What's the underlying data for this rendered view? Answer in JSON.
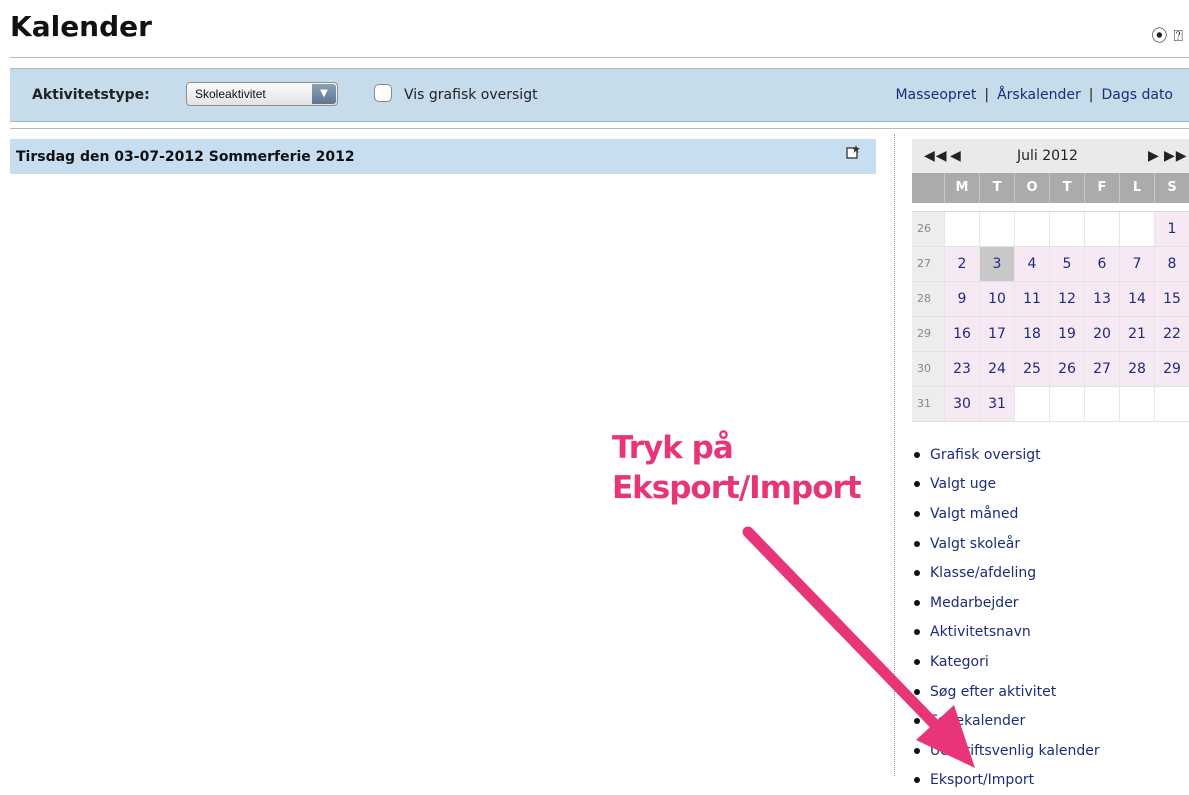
{
  "page": {
    "title": "Kalender"
  },
  "toolbar": {
    "activity_type_label": "Aktivitetstype:",
    "activity_type_value": "Skoleaktivitet",
    "graphic_overview_label": "Vis grafisk oversigt",
    "links": [
      "Masseopret",
      "Årskalender",
      "Dags dato"
    ],
    "separator": "|"
  },
  "day": {
    "heading": "Tirsdag den 03-07-2012  Sommerferie 2012"
  },
  "calendar": {
    "month_label": "Juli 2012",
    "prev_year": "◀◀",
    "prev_month": "◀",
    "next_month": "▶",
    "next_year": "▶▶",
    "weekdays": [
      "M",
      "T",
      "O",
      "T",
      "F",
      "L",
      "S"
    ],
    "rows": [
      {
        "week": "26",
        "days": [
          "",
          "",
          "",
          "",
          "",
          "",
          "1"
        ]
      },
      {
        "week": "27",
        "days": [
          "2",
          "3",
          "4",
          "5",
          "6",
          "7",
          "8"
        ]
      },
      {
        "week": "28",
        "days": [
          "9",
          "10",
          "11",
          "12",
          "13",
          "14",
          "15"
        ]
      },
      {
        "week": "29",
        "days": [
          "16",
          "17",
          "18",
          "19",
          "20",
          "21",
          "22"
        ]
      },
      {
        "week": "30",
        "days": [
          "23",
          "24",
          "25",
          "26",
          "27",
          "28",
          "29"
        ]
      },
      {
        "week": "31",
        "days": [
          "30",
          "31",
          "",
          "",
          "",
          "",
          ""
        ]
      }
    ],
    "selected_day": "3"
  },
  "side_links": [
    "Grafisk oversigt",
    "Valgt uge",
    "Valgt måned",
    "Valgt skoleår",
    "Klasse/afdeling",
    "Medarbejder",
    "Aktivitetsnavn",
    "Kategori",
    "Søg efter aktivitet",
    "Feriekalender",
    "Udskriftsvenlig kalender",
    "Eksport/Import"
  ],
  "annotation": {
    "line1": "Tryk på",
    "line2": "Eksport/Import"
  },
  "colors": {
    "annotation": "#e8357a",
    "link": "#1c2c7a",
    "toolbar_bg": "#c6dcea"
  },
  "icons": {
    "top": [
      "play-circle-icon",
      "help-icon"
    ],
    "day": "new-note-icon"
  }
}
